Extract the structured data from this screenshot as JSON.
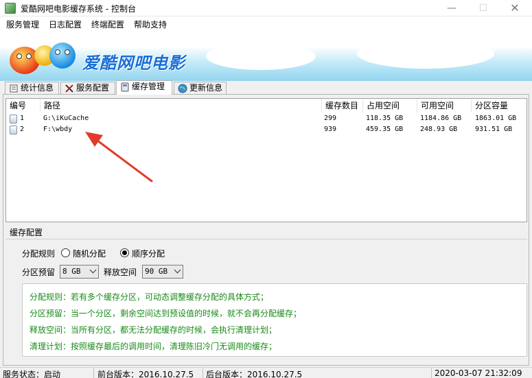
{
  "window": {
    "title": "爱酷网吧电影缓存系统 - 控制台",
    "controls": {
      "minimize": "—",
      "maximize": "☐",
      "close": "✕"
    }
  },
  "menu": [
    "服务管理",
    "日志配置",
    "终端配置",
    "帮助支持"
  ],
  "banner": {
    "brand_text": "爱酷网吧电影"
  },
  "tabs": [
    {
      "label": "统计信息",
      "icon": "stats-icon",
      "active": false
    },
    {
      "label": "服务配置",
      "icon": "tools-icon",
      "active": false
    },
    {
      "label": "缓存管理",
      "icon": "disk-icon",
      "active": true
    },
    {
      "label": "更新信息",
      "icon": "globe-icon",
      "active": false
    }
  ],
  "cache_list": {
    "columns": [
      "编号",
      "路径",
      "缓存数目",
      "占用空间",
      "可用空间",
      "分区容量"
    ],
    "rows": [
      {
        "id": "1",
        "path": "G:\\iKuCache",
        "count": "299",
        "used": "118.35 GB",
        "free": "1184.86 GB",
        "capacity": "1863.01 GB"
      },
      {
        "id": "2",
        "path": "F:\\wbdy",
        "count": "939",
        "used": "459.35 GB",
        "free": "248.93 GB",
        "capacity": "931.51 GB"
      }
    ]
  },
  "config": {
    "group_title": "缓存配置",
    "alloc_label": "分配规则",
    "alloc_options": [
      "随机分配",
      "顺序分配"
    ],
    "alloc_selected": "顺序分配",
    "reserve_label": "分区预留",
    "reserve_value": "8 GB",
    "release_label": "释放空间",
    "release_value": "90 GB",
    "help_lines": [
      "分配规则：若有多个缓存分区，可动态调整缓存分配的具体方式；",
      "分区预留：当一个分区，剩余空间达到预设值的时候，就不会再分配缓存；",
      "释放空间：当所有分区，都无法分配缓存的时候，会执行清理计划；",
      "清理计划：按照缓存最后的调用时间，清理陈旧冷门无调用的缓存；"
    ],
    "help_color": "#1a8a1a"
  },
  "status": {
    "service_state": "服务状态：启动",
    "front_version": "前台版本：2016.10.27.5",
    "back_version": "后台版本：2016.10.27.5",
    "datetime": "2020-03-07 21:32:09"
  },
  "colors": {
    "brand": "#1a6fd6",
    "annotation_arrow": "#e23a2c"
  }
}
